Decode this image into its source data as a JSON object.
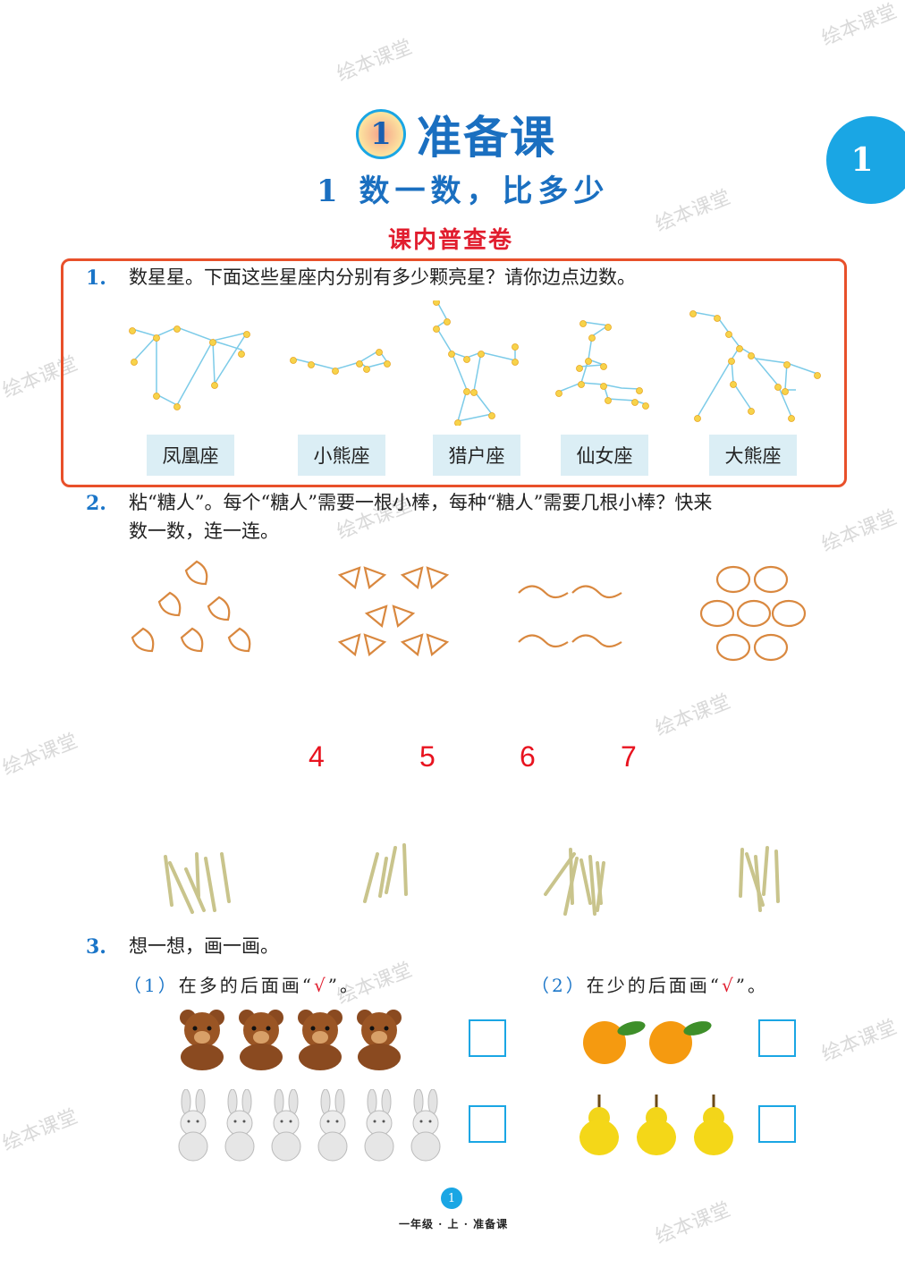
{
  "watermark": "绘本课堂",
  "unit_badge": "1",
  "title": {
    "number": "1",
    "text": "准备课"
  },
  "subtitle": "1  数一数，比多少",
  "section_heading": "课内普查卷",
  "q1": {
    "number": "1.",
    "text": "数星星。下面这些星座内分别有多少颗亮星？请你边点边数。",
    "labels": [
      "凤凰座",
      "小熊座",
      "猎户座",
      "仙女座",
      "大熊座"
    ]
  },
  "q2": {
    "number": "2.",
    "line1": "粘“糖人”。每个“糖人”需要一根小棒，每种“糖人”需要几根小棒？快来",
    "line2": "数一数，连一连。",
    "numbers": [
      "4",
      "5",
      "6",
      "7"
    ]
  },
  "q3": {
    "number": "3.",
    "text": "想一想，画一画。",
    "part1": {
      "paren": "（1）",
      "text": "在多的后面画“",
      "mark": "√",
      "end": "”。"
    },
    "part2": {
      "paren": "（2）",
      "text": "在少的后面画“",
      "mark": "√",
      "end": "”。"
    }
  },
  "page_number": "1",
  "footer": "一年级 · 上 · 准备课",
  "colors": {
    "accent_blue": "#1aa6e4",
    "title_blue": "#1a6fc0",
    "red": "#e11d2e",
    "frame": "#e8502a",
    "label_bg": "#dbeef5"
  }
}
